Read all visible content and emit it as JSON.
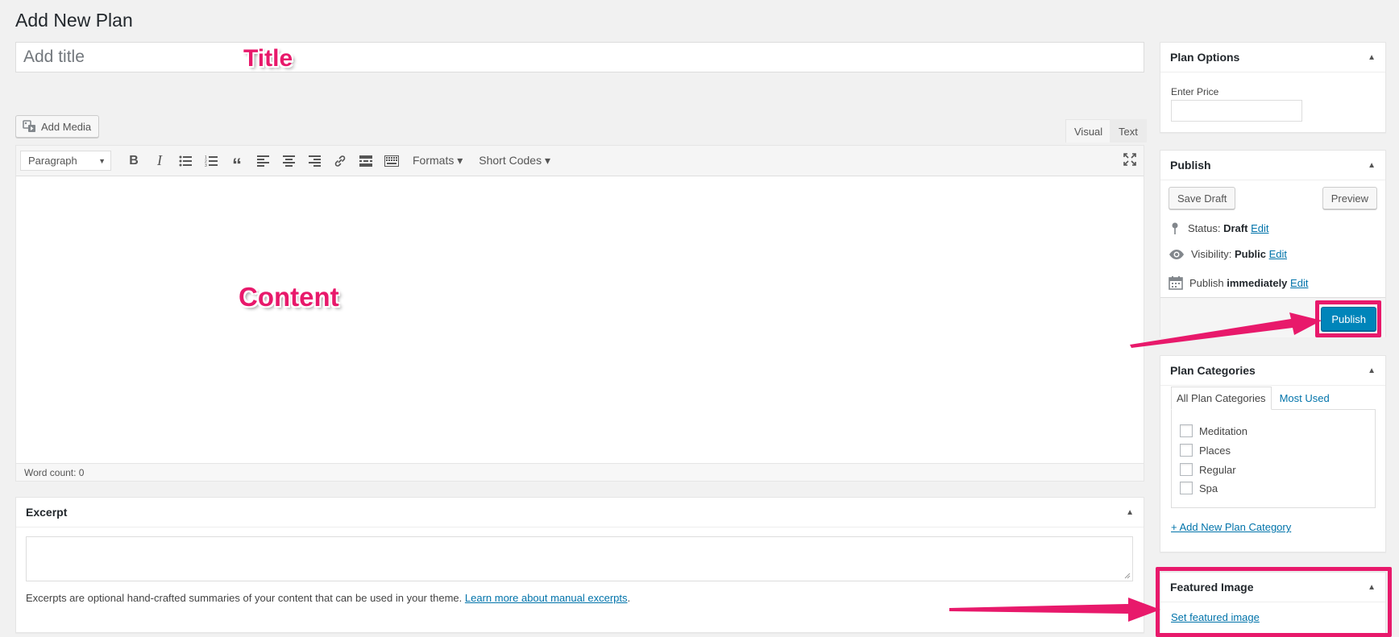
{
  "page": {
    "title": "Add New Plan"
  },
  "title_field": {
    "placeholder": "Add title"
  },
  "annotations": {
    "title_label": "Title",
    "content_label": "Content"
  },
  "editor": {
    "add_media_label": "Add Media",
    "tabs": {
      "visual": "Visual",
      "text": "Text"
    },
    "toolbar": {
      "format_select": "Paragraph",
      "formats_label": "Formats ▾",
      "shortcodes_label": "Short Codes ▾"
    },
    "word_count": "Word count: 0"
  },
  "excerpt": {
    "title": "Excerpt",
    "help_text": "Excerpts are optional hand-crafted summaries of your content that can be used in your theme.",
    "help_link": "Learn more about manual excerpts",
    "help_suffix": "."
  },
  "plan_options": {
    "title": "Plan Options",
    "price_label": "Enter Price",
    "price_value": ""
  },
  "publish": {
    "title": "Publish",
    "save_draft": "Save Draft",
    "preview": "Preview",
    "status_label": "Status:",
    "status_value": "Draft",
    "visibility_label": "Visibility:",
    "visibility_value": "Public",
    "schedule_label": "Publish",
    "schedule_value": "immediately",
    "edit_label": "Edit",
    "publish_button": "Publish"
  },
  "plan_categories": {
    "title": "Plan Categories",
    "tabs": [
      "All Plan Categories",
      "Most Used"
    ],
    "items": [
      "Meditation",
      "Places",
      "Regular",
      "Spa"
    ],
    "add_new": "+ Add New Plan Category"
  },
  "featured_image": {
    "title": "Featured Image",
    "set_link": "Set featured image"
  },
  "colors": {
    "accent": "#e8196b",
    "primary_button": "#0085ba",
    "link": "#0073aa"
  }
}
